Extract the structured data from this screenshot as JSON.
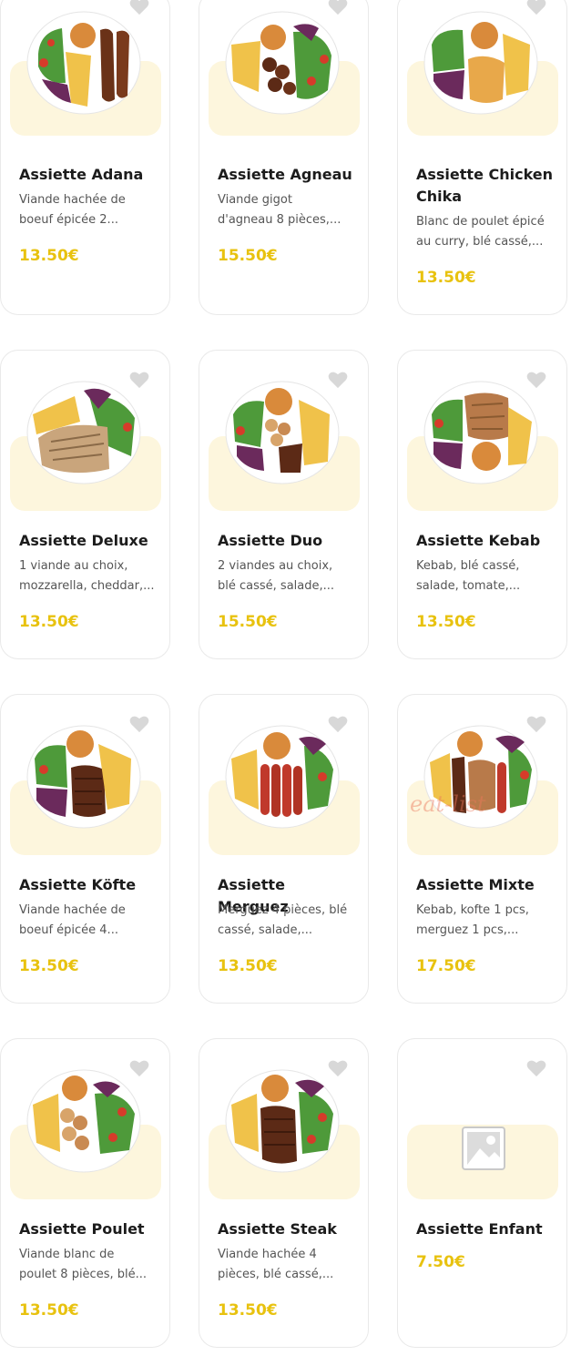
{
  "colors": {
    "price": "#e8c20f",
    "blob": "#fdf6dd",
    "heart": "#d8d8d8",
    "title": "#1c1c1c",
    "desc": "#555555"
  },
  "icons": {
    "favorite": "heart-icon",
    "image_placeholder": "image-placeholder-icon"
  },
  "items": [
    {
      "title": "Assiette Adana",
      "desc_line1": "Viande hachée de",
      "desc_line2": "boeuf épicée 2...",
      "price": "13.50€"
    },
    {
      "title": "Assiette Agneau",
      "desc_line1": "Viande gigot",
      "desc_line2": "d'agneau 8 pièces,...",
      "price": "15.50€"
    },
    {
      "title": "Assiette Chicken Chika",
      "desc_line1": "Blanc de poulet épicé",
      "desc_line2": "au curry, blé cassé,...",
      "price": "13.50€"
    },
    {
      "title": "Assiette Deluxe",
      "desc_line1": "1 viande au choix,",
      "desc_line2": "mozzarella, cheddar,...",
      "price": "13.50€"
    },
    {
      "title": "Assiette Duo",
      "desc_line1": "2 viandes au choix,",
      "desc_line2": "blé cassé, salade,...",
      "price": "15.50€"
    },
    {
      "title": "Assiette Kebab",
      "desc_line1": "Kebab, blé cassé,",
      "desc_line2": "salade, tomate,...",
      "price": "13.50€"
    },
    {
      "title": "Assiette Köfte",
      "desc_line1": "Viande hachée de",
      "desc_line2": "boeuf épicée 4...",
      "price": "13.50€"
    },
    {
      "title": "Assiette Merguez",
      "desc_line1": "Merguez 4 pièces, blé",
      "desc_line2": "cassé, salade,...",
      "price": "13.50€"
    },
    {
      "title": "Assiette Mixte",
      "desc_line1": "Kebab, kofte 1 pcs,",
      "desc_line2": "merguez 1 pcs,...",
      "price": "17.50€"
    },
    {
      "title": "Assiette Poulet",
      "desc_line1": "Viande blanc de",
      "desc_line2": "poulet 8 pièces, blé...",
      "price": "13.50€"
    },
    {
      "title": "Assiette Steak",
      "desc_line1": "Viande hachée 4",
      "desc_line2": "pièces, blé cassé,...",
      "price": "13.50€"
    },
    {
      "title": "Assiette Enfant",
      "price": "7.50€"
    }
  ],
  "watermark": "eat-list"
}
